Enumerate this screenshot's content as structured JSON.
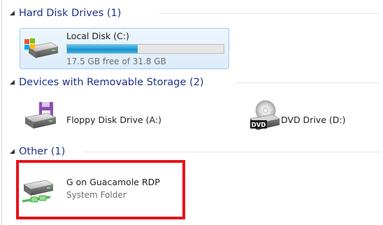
{
  "groups": [
    {
      "header": "Hard Disk Drives (1)",
      "items": [
        {
          "name": "Local Disk (C:)",
          "detail": "17.5 GB free of 31.8 GB",
          "used_fraction": 0.45,
          "icon": "windows-drive-icon",
          "selected": true
        }
      ]
    },
    {
      "header": "Devices with Removable Storage (2)",
      "items": [
        {
          "name": "Floppy Disk Drive (A:)",
          "icon": "floppy-drive-icon"
        },
        {
          "name": "DVD Drive (D:)",
          "icon": "dvd-drive-icon",
          "icon_label": "DVD"
        }
      ]
    },
    {
      "header": "Other (1)",
      "items": [
        {
          "name": "G on Guacamole RDP",
          "detail": "System Folder",
          "icon": "network-drive-icon",
          "highlighted": true
        }
      ]
    }
  ],
  "colors": {
    "header_text": "#1e3287",
    "selection_border": "#9fcaf0",
    "progress_fill": "#26a0da",
    "highlight": "#e8121a"
  }
}
